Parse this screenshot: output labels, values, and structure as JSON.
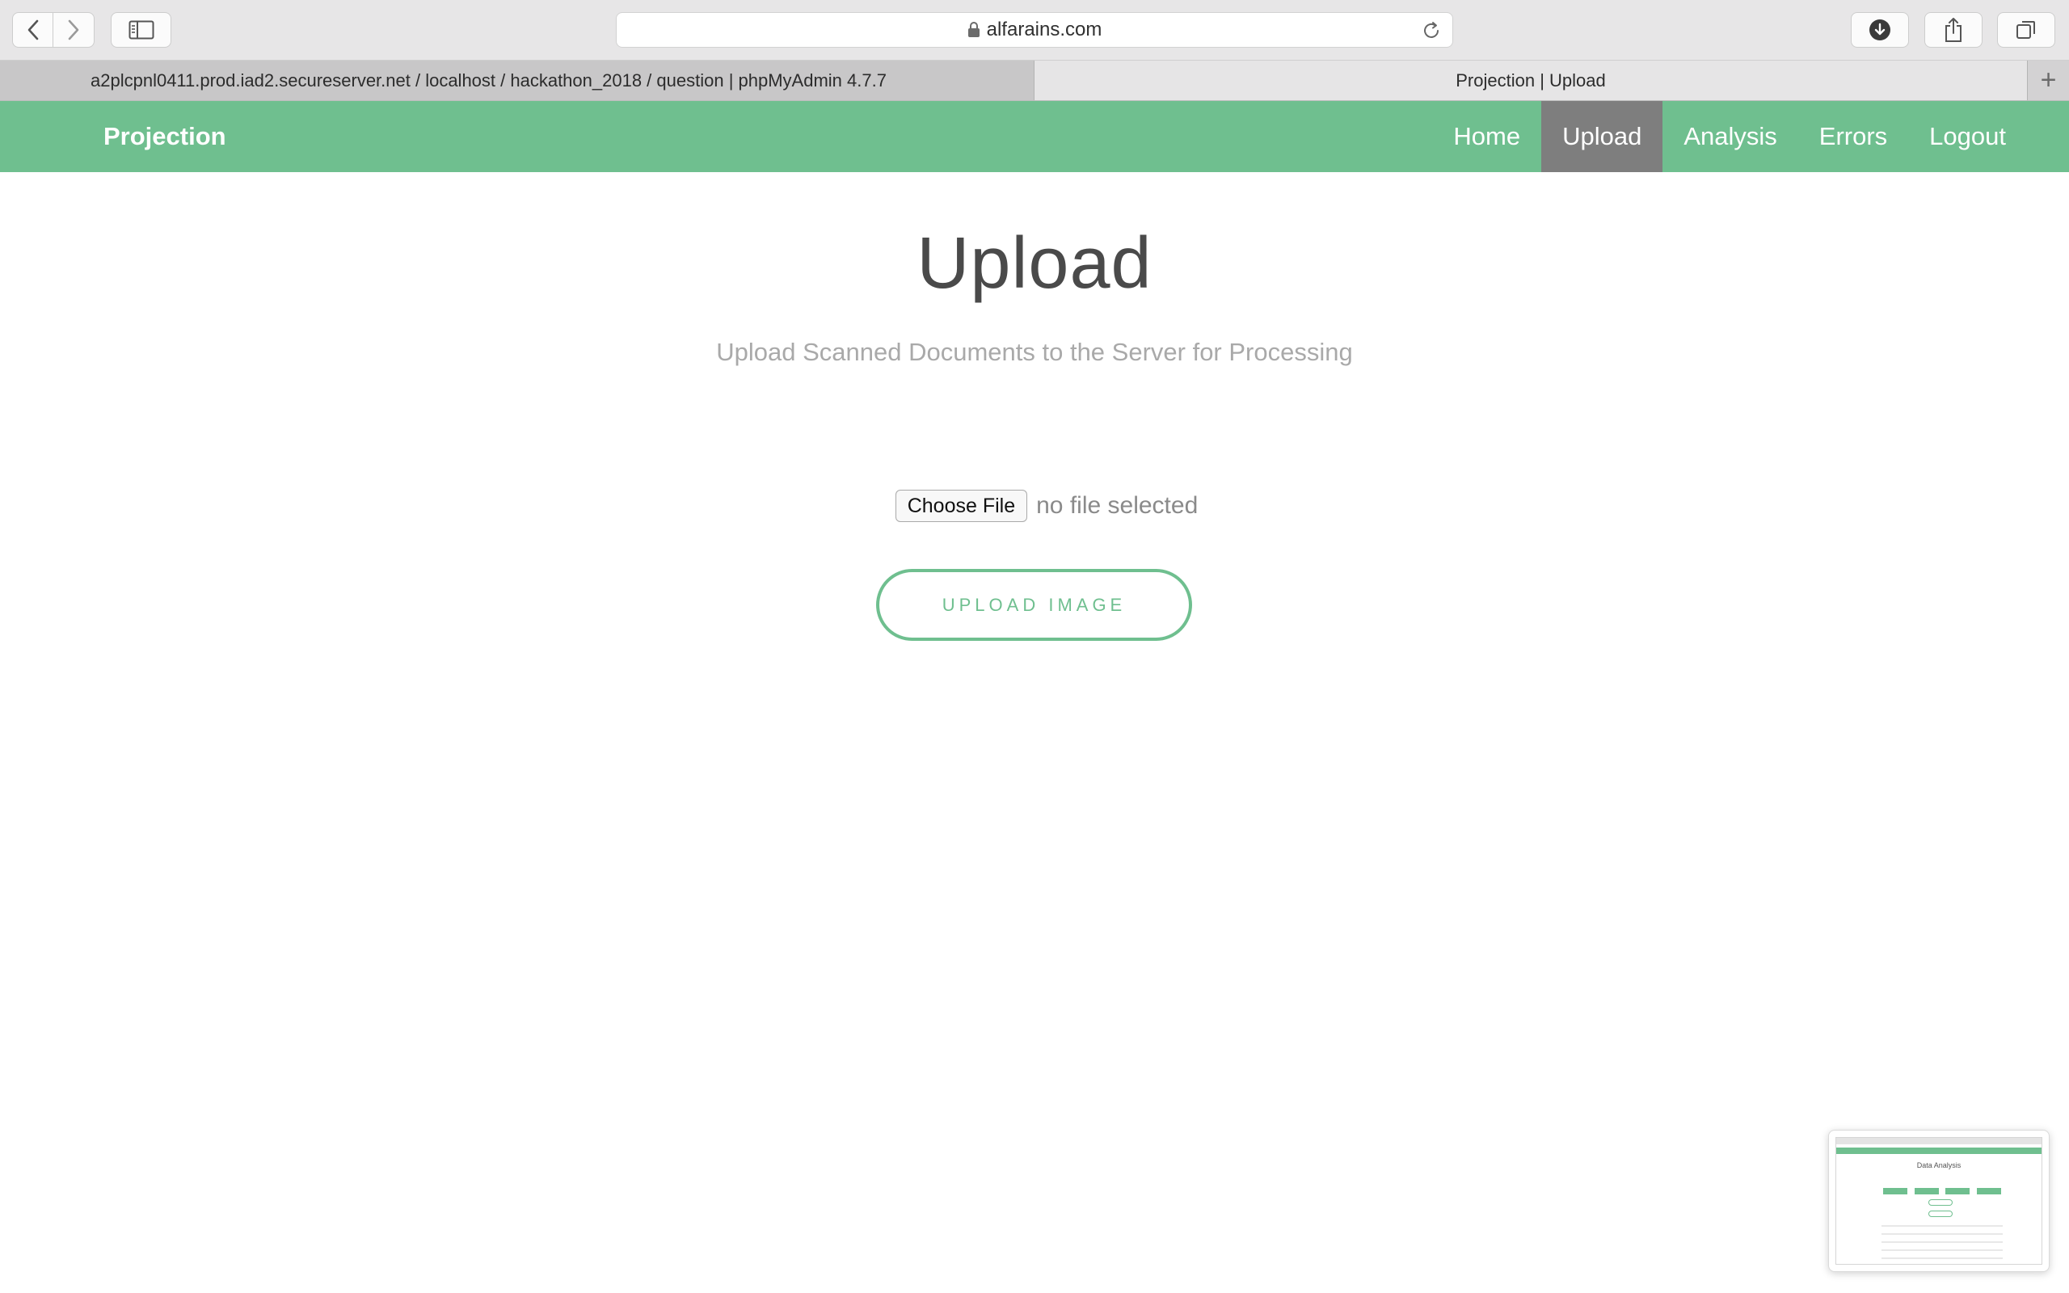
{
  "browser": {
    "url": "alfarains.com",
    "tabs": [
      {
        "label": "a2plcpnl0411.prod.iad2.secureserver.net / localhost / hackathon_2018 / question | phpMyAdmin 4.7.7",
        "active": false
      },
      {
        "label": "Projection | Upload",
        "active": true
      }
    ],
    "new_tab": "+"
  },
  "site": {
    "brand": "Projection",
    "nav": [
      {
        "label": "Home",
        "active": false
      },
      {
        "label": "Upload",
        "active": true
      },
      {
        "label": "Analysis",
        "active": false
      },
      {
        "label": "Errors",
        "active": false
      },
      {
        "label": "Logout",
        "active": false
      }
    ]
  },
  "main": {
    "title": "Upload",
    "subtitle": "Upload Scanned Documents to the Server for Processing",
    "file_input": {
      "button_label": "Choose File",
      "status": "no file selected"
    },
    "upload_button": "UPLOAD IMAGE"
  },
  "thumbnail": {
    "title": "Data Analysis"
  },
  "colors": {
    "accent": "#6fbf8f",
    "active_nav": "#7e7e7e"
  }
}
